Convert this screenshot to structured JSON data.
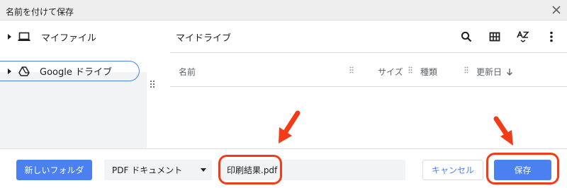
{
  "window": {
    "title": "名前を付けて保存",
    "close_icon": "close-icon"
  },
  "sidebar": {
    "items": [
      {
        "label": "マイファイル",
        "icon": "laptop-icon",
        "selected": false
      },
      {
        "label": "Google ドライブ",
        "icon": "google-drive-icon",
        "selected": true
      }
    ]
  },
  "main": {
    "breadcrumb": "マイドライブ",
    "toolbar": {
      "search_icon": "search-icon",
      "grid_icon": "grid-view-icon",
      "sort_icon": "sort-az-icon",
      "more_icon": "more-vert-icon"
    },
    "columns": {
      "name": "名前",
      "size": "サイズ",
      "type": "種類",
      "modified": "更新日"
    }
  },
  "footer": {
    "new_folder_label": "新しいフォルダ",
    "file_type_selected": "PDF ドキュメント",
    "filename_value": "印刷結果.pdf",
    "cancel_label": "キャンセル",
    "save_label": "保存"
  },
  "colors": {
    "accent": "#4a80f0",
    "annotation": "#f23c18",
    "titlebar_bg": "#eeeeee"
  }
}
